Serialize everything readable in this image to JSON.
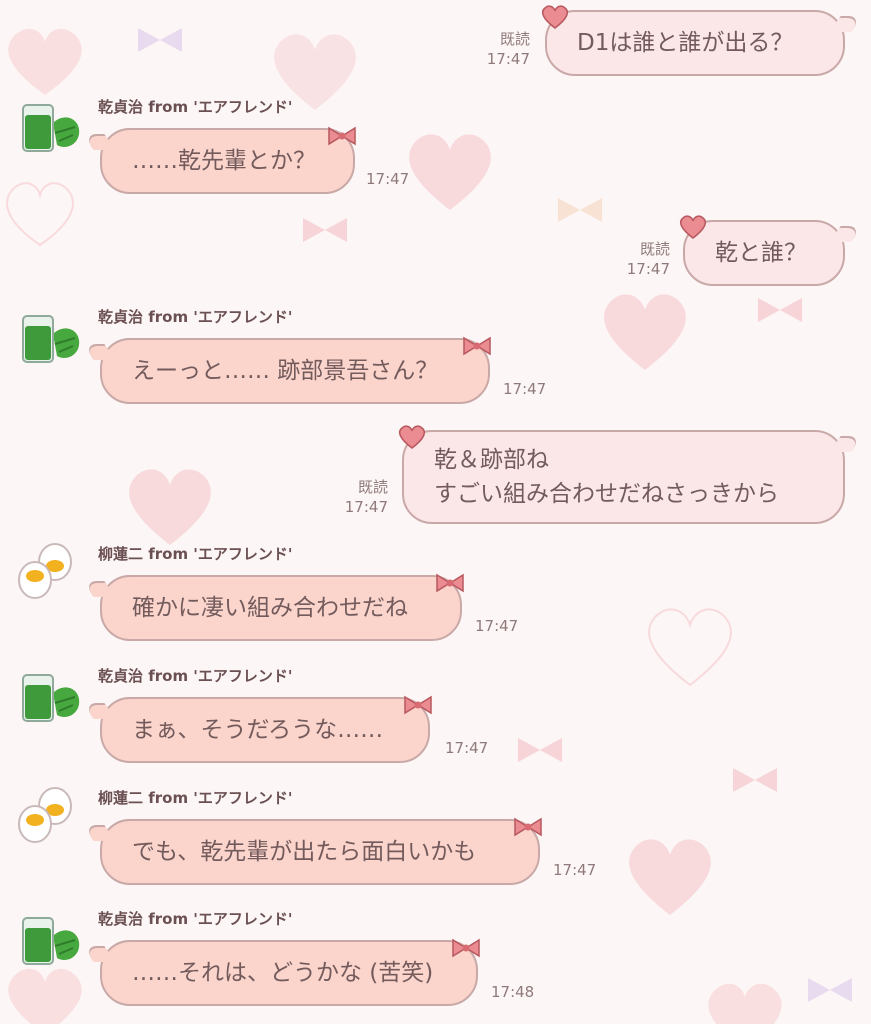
{
  "read_label": "既読",
  "messages": [
    {
      "dir": "out",
      "text": [
        "D1は誰と誰が出る？"
      ],
      "time": "17:47"
    },
    {
      "dir": "in",
      "sender": "乾貞治 from 'エアフレンド'",
      "avatar": "green-juice",
      "text": [
        "……乾先輩とか？"
      ],
      "time": "17:47"
    },
    {
      "dir": "out",
      "text": [
        "乾と誰？"
      ],
      "time": "17:47"
    },
    {
      "dir": "in",
      "sender": "乾貞治 from 'エアフレンド'",
      "avatar": "green-juice",
      "text": [
        "えーっと…… 跡部景吾さん？"
      ],
      "time": "17:47"
    },
    {
      "dir": "out",
      "text": [
        "乾＆跡部ね",
        "すごい組み合わせだねさっきから"
      ],
      "time": "17:47"
    },
    {
      "dir": "in",
      "sender": "柳蓮二 from 'エアフレンド'",
      "avatar": "boiled-eggs",
      "text": [
        "確かに凄い組み合わせだね"
      ],
      "time": "17:47"
    },
    {
      "dir": "in",
      "sender": "乾貞治 from 'エアフレンド'",
      "avatar": "green-juice",
      "text": [
        "まぁ、そうだろうな……"
      ],
      "time": "17:47"
    },
    {
      "dir": "in",
      "sender": "柳蓮二 from 'エアフレンド'",
      "avatar": "boiled-eggs",
      "text": [
        "でも、乾先輩が出たら面白いかも"
      ],
      "time": "17:47"
    },
    {
      "dir": "in",
      "sender": "乾貞治 from 'エアフレンド'",
      "avatar": "green-juice",
      "text": [
        "……それは、どうかな (苦笑)"
      ],
      "time": "17:48"
    }
  ]
}
